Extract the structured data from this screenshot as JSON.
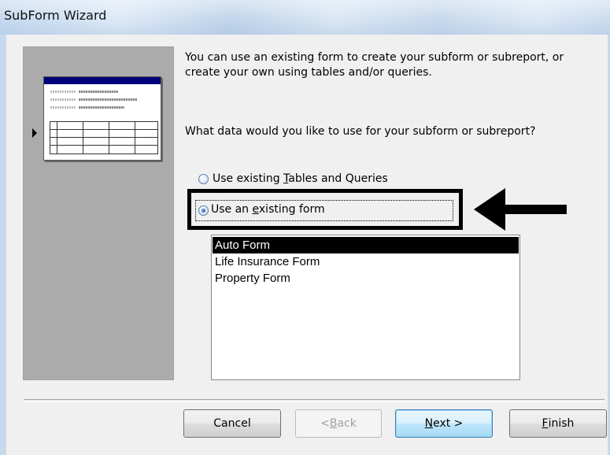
{
  "window": {
    "title": "SubForm Wizard"
  },
  "intro": {
    "line1": "You can use an existing form to create your subform or subreport, or",
    "line2": "create your own using tables and/or queries."
  },
  "question": "What data would you like to use for your subform or subreport?",
  "options": [
    {
      "pre": "Use existing ",
      "accel": "T",
      "post": "ables and Queries",
      "selected": false
    },
    {
      "pre": "Use an ",
      "accel": "e",
      "post": "xisting form",
      "selected": true
    }
  ],
  "forms_list": {
    "items": [
      "Auto Form",
      "Life Insurance Form",
      "Property Form"
    ],
    "selected": "Auto Form"
  },
  "buttons": {
    "cancel": {
      "label": "Cancel",
      "enabled": true
    },
    "back": {
      "pre": "< ",
      "accel": "B",
      "post": "ack",
      "enabled": false
    },
    "next": {
      "accel": "N",
      "post": "ext >",
      "enabled": true
    },
    "finish": {
      "accel": "F",
      "post": "inish",
      "enabled": true
    }
  },
  "colors": {
    "list_selection_bg": "#000000",
    "annotation": "#000000",
    "preview_panel": "#ababab",
    "titlebar": "#c4d8ee"
  }
}
